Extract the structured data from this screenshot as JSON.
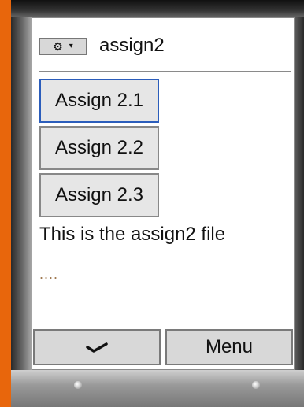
{
  "app": {
    "title": "assign2"
  },
  "header": {
    "icon_name": "command-menu-icon",
    "dropdown_icon_name": "dropdown-arrow-icon"
  },
  "buttons": [
    {
      "label": "Assign 2.1",
      "focused": true
    },
    {
      "label": "Assign 2.2",
      "focused": false
    },
    {
      "label": "Assign 2.3",
      "focused": false
    }
  ],
  "body_text": "This is the assign2 file",
  "dots": "....",
  "softkeys": {
    "left_icon": "checkmark-icon",
    "right_label": "Menu"
  },
  "colors": {
    "background_orange": "#e8660c",
    "focus_border": "#2b5dbb",
    "dots_color": "#a07850"
  }
}
